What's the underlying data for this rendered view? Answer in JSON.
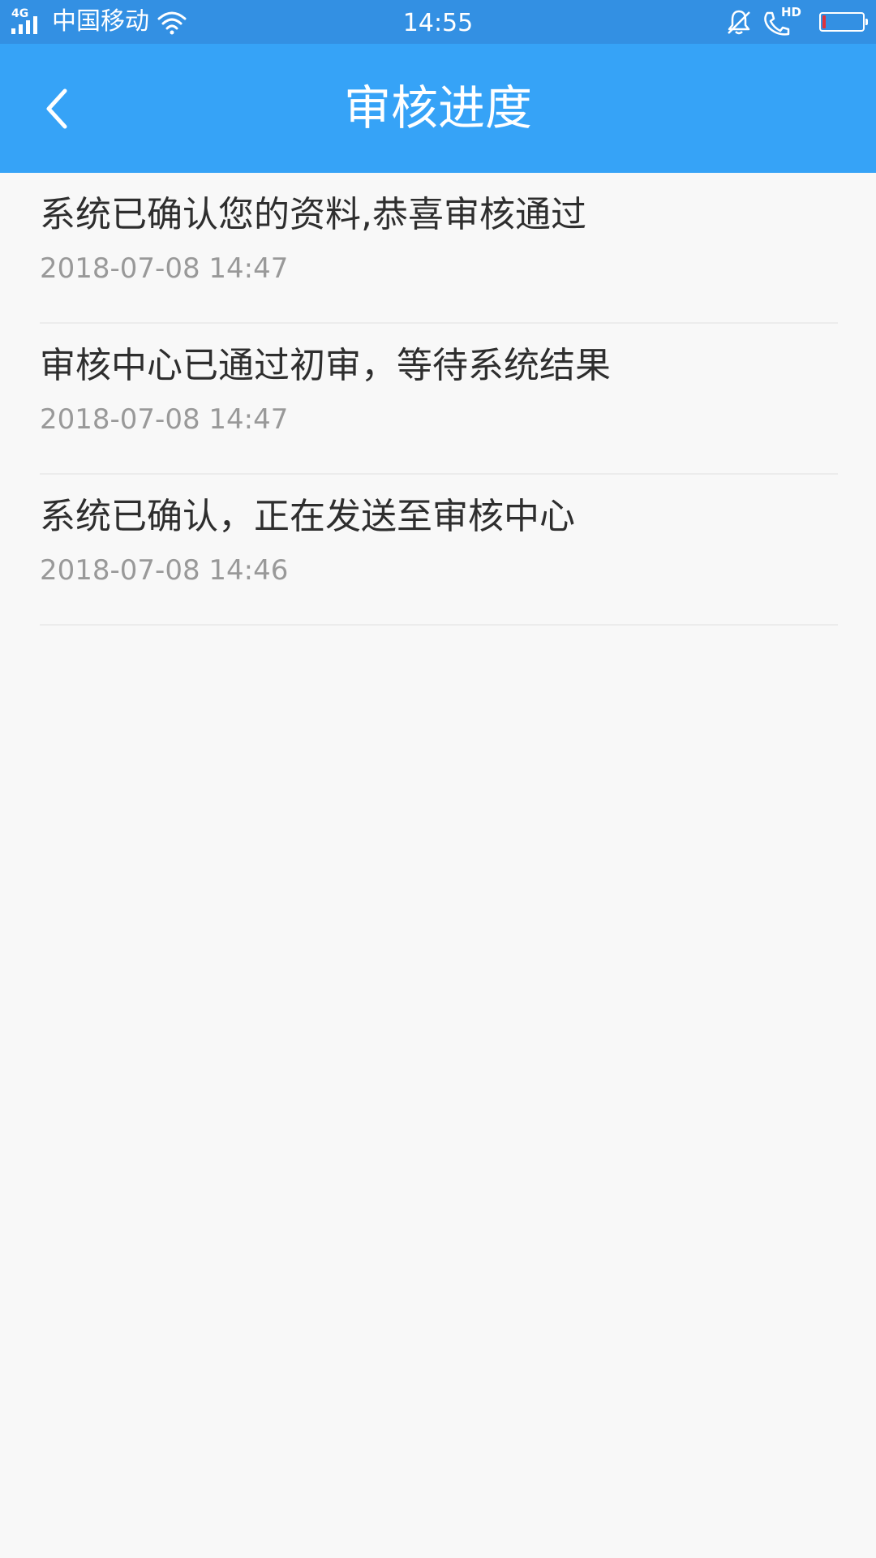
{
  "status_bar": {
    "network": "4G",
    "carrier": "中国移动",
    "time": "14:55",
    "hd": "HD",
    "battery_level": 0.08,
    "battery_color": "#e0323a"
  },
  "nav": {
    "title": "审核进度",
    "background": "#36a3f7",
    "back_icon": "chevron-left-icon"
  },
  "progress": {
    "items": [
      {
        "message": "系统已确认您的资料,恭喜审核通过",
        "time": "2018-07-08 14:47"
      },
      {
        "message": "审核中心已通过初审，等待系统结果",
        "time": "2018-07-08 14:47"
      },
      {
        "message": "系统已确认，正在发送至审核中心",
        "time": "2018-07-08 14:46"
      }
    ]
  }
}
